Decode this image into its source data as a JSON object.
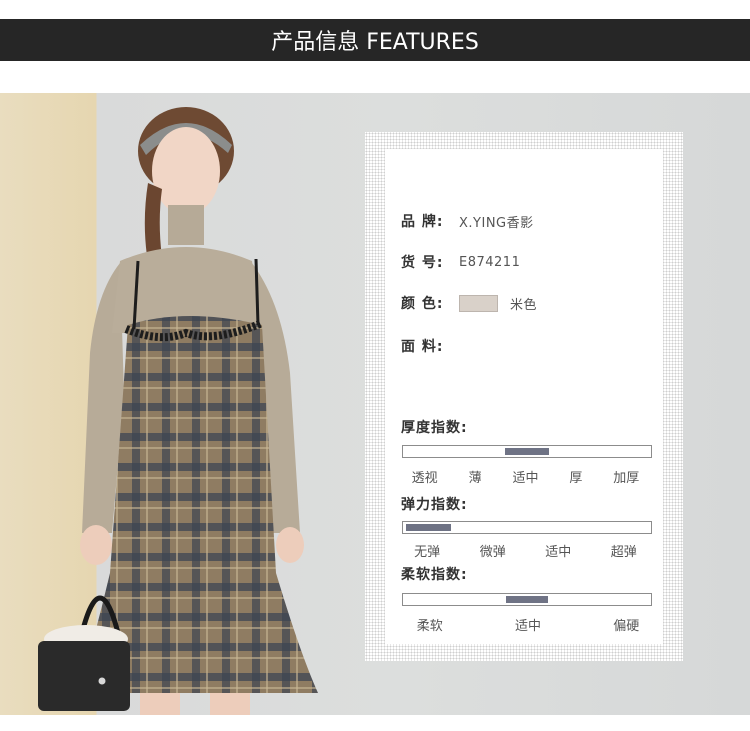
{
  "header": {
    "title": "产品信息 FEATURES"
  },
  "product": {
    "brand_label": "品  牌:",
    "brand_value": "X.YING香影",
    "sku_label": "货  号:",
    "sku_value": "E874211",
    "color_label": "颜  色:",
    "color_name": "米色",
    "color_hex": "#d9d1c9",
    "fabric_label": "面  料:"
  },
  "indices": {
    "thickness": {
      "title": "厚度指数:",
      "options": [
        "透视",
        "薄",
        "适中",
        "厚",
        "加厚"
      ],
      "selected": "适中"
    },
    "elasticity": {
      "title": "弹力指数:",
      "options": [
        "无弹",
        "微弹",
        "适中",
        "超弹"
      ],
      "selected": "无弹"
    },
    "softness": {
      "title": "柔软指数:",
      "options": [
        "柔软",
        "适中",
        "偏硬"
      ],
      "selected": "适中"
    }
  },
  "colors": {
    "header_bg": "#262626",
    "indicator": "#6f7385",
    "track_border": "#8c8c8c"
  }
}
